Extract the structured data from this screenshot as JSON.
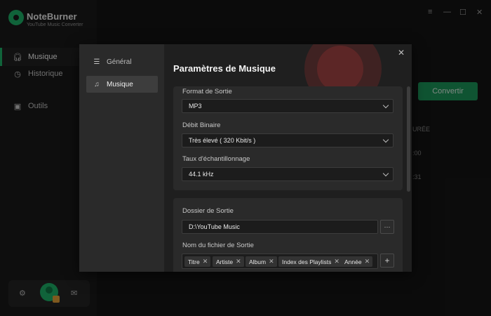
{
  "app": {
    "name": "NoteBurner",
    "subtitle": "YouTube Music Converter"
  },
  "sidebar": {
    "items": [
      {
        "label": "Musique",
        "icon": "headphones-icon",
        "active": true
      },
      {
        "label": "Historique",
        "icon": "clock-icon",
        "active": false
      },
      {
        "label": "Outils",
        "icon": "toolbox-icon",
        "active": false
      }
    ]
  },
  "window_controls": {
    "menu": "≡",
    "minimize": "—",
    "maximize": "☐",
    "close": "✕"
  },
  "main": {
    "convert_label": "Convertir",
    "column_partial": "URÉE",
    "duration_1": ":00",
    "duration_2": ":31"
  },
  "dialog": {
    "title": "Paramètres de Musique",
    "nav": [
      {
        "label": "Général",
        "icon": "sliders-icon",
        "active": false
      },
      {
        "label": "Musique",
        "icon": "music-note-icon",
        "active": true
      }
    ],
    "output_format": {
      "label": "Format de Sortie",
      "value": "MP3"
    },
    "bitrate": {
      "label": "Débit Binaire",
      "value": "Très élevé ( 320 Kbit/s )"
    },
    "sample_rate": {
      "label": "Taux d'échantillonnage",
      "value": "44.1 kHz"
    },
    "output_folder": {
      "label": "Dossier de Sortie",
      "value": "D:\\YouTube Music",
      "browse": "···"
    },
    "file_name": {
      "label": "Nom du fichier de Sortie",
      "tags": [
        "Titre",
        "Artiste",
        "Album",
        "Index des Playlists",
        "Année"
      ],
      "add": "+"
    }
  },
  "colors": {
    "accent": "#1eb46a",
    "button": "#1c9a5c"
  }
}
